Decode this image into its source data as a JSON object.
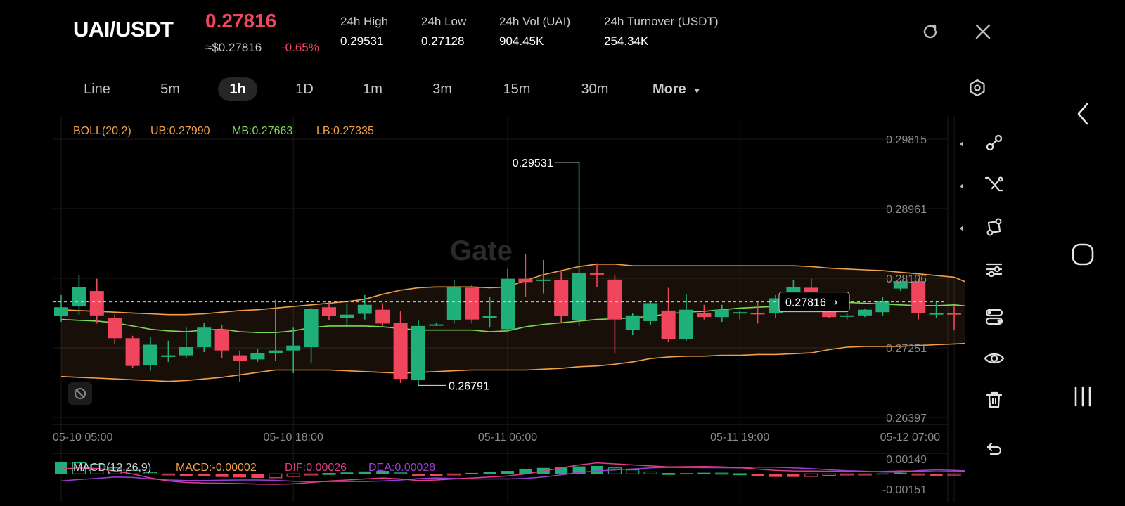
{
  "header": {
    "pair": "UAI/USDT",
    "last_price": "0.27816",
    "approx_price": "≈$0.27816",
    "change_pct": "-0.65%",
    "stats": [
      {
        "label": "24h   High",
        "value": "0.29531"
      },
      {
        "label": "24h   Low",
        "value": "0.27128"
      },
      {
        "label": "24h   Vol (UAI)",
        "value": "904.45K"
      },
      {
        "label": "24h   Turnover (USDT)",
        "value": "254.34K"
      }
    ]
  },
  "timeframes": [
    {
      "label": "Line",
      "active": false
    },
    {
      "label": "5m",
      "active": false
    },
    {
      "label": "1h",
      "active": true
    },
    {
      "label": "1D",
      "active": false
    },
    {
      "label": "1m",
      "active": false
    },
    {
      "label": "3m",
      "active": false
    },
    {
      "label": "15m",
      "active": false
    },
    {
      "label": "30m",
      "active": false
    },
    {
      "label": "More",
      "active": false
    }
  ],
  "indicators": {
    "boll": {
      "name": "BOLL(20,2)",
      "ub": "UB:0.27990",
      "mb": "MB:0.27663",
      "lb": "LB:0.27335"
    },
    "macd": {
      "name": "MACD(12,26,9)",
      "macd": "MACD:-0.00002",
      "dif": "DIF:0.00026",
      "dea": "DEA:0.00028"
    }
  },
  "watermark": "Gate",
  "colors": {
    "up": "#1fb07a",
    "down": "#f0465d",
    "boll_ub": "#f0a04a",
    "boll_mb": "#7ed957",
    "boll_lb": "#f0a04a",
    "dif": "#e03c8a",
    "dea": "#9b3fd6",
    "accent_orange": "#f0a04a"
  },
  "chart_data": {
    "type": "candlestick",
    "y_ticks": [
      "0.29815",
      "0.28961",
      "0.28106",
      "0.27251",
      "0.26397"
    ],
    "ylim": [
      0.26397,
      0.29815
    ],
    "x_ticks": [
      {
        "label": "05-10 05:00",
        "index": 0
      },
      {
        "label": "05-10 18:00",
        "index": 13
      },
      {
        "label": "05-11 06:00",
        "index": 25
      },
      {
        "label": "05-11 19:00",
        "index": 38
      },
      {
        "label": "05-12 07:00",
        "index": 50
      }
    ],
    "current_price": "0.27816",
    "high_marker": {
      "label": "0.29531",
      "index": 29,
      "value": 0.29531
    },
    "low_marker": {
      "label": "0.26791",
      "index": 20,
      "value": 0.26791
    },
    "candles": [
      {
        "o": 0.2764,
        "h": 0.279,
        "l": 0.2757,
        "c": 0.2775
      },
      {
        "o": 0.2776,
        "h": 0.2814,
        "l": 0.2766,
        "c": 0.28
      },
      {
        "o": 0.2795,
        "h": 0.281,
        "l": 0.2755,
        "c": 0.2765
      },
      {
        "o": 0.2762,
        "h": 0.2766,
        "l": 0.273,
        "c": 0.2737
      },
      {
        "o": 0.2737,
        "h": 0.274,
        "l": 0.27,
        "c": 0.2703
      },
      {
        "o": 0.2704,
        "h": 0.2738,
        "l": 0.2697,
        "c": 0.2729
      },
      {
        "o": 0.2714,
        "h": 0.2734,
        "l": 0.2708,
        "c": 0.2716
      },
      {
        "o": 0.2716,
        "h": 0.275,
        "l": 0.2713,
        "c": 0.2726
      },
      {
        "o": 0.2726,
        "h": 0.2756,
        "l": 0.272,
        "c": 0.275
      },
      {
        "o": 0.2748,
        "h": 0.2753,
        "l": 0.2713,
        "c": 0.2722
      },
      {
        "o": 0.2716,
        "h": 0.2722,
        "l": 0.2683,
        "c": 0.2709
      },
      {
        "o": 0.2711,
        "h": 0.2724,
        "l": 0.2708,
        "c": 0.2719
      },
      {
        "o": 0.2719,
        "h": 0.2784,
        "l": 0.2709,
        "c": 0.2722
      },
      {
        "o": 0.2722,
        "h": 0.275,
        "l": 0.2694,
        "c": 0.2728
      },
      {
        "o": 0.2726,
        "h": 0.2774,
        "l": 0.2706,
        "c": 0.2773
      },
      {
        "o": 0.2775,
        "h": 0.2782,
        "l": 0.2759,
        "c": 0.2764
      },
      {
        "o": 0.2762,
        "h": 0.278,
        "l": 0.275,
        "c": 0.2766
      },
      {
        "o": 0.2767,
        "h": 0.279,
        "l": 0.276,
        "c": 0.2778
      },
      {
        "o": 0.2772,
        "h": 0.278,
        "l": 0.2752,
        "c": 0.2755
      },
      {
        "o": 0.2756,
        "h": 0.277,
        "l": 0.2682,
        "c": 0.2687
      },
      {
        "o": 0.2686,
        "h": 0.2759,
        "l": 0.2679,
        "c": 0.2752
      },
      {
        "o": 0.2754,
        "h": 0.2756,
        "l": 0.2752,
        "c": 0.2754
      },
      {
        "o": 0.2759,
        "h": 0.2809,
        "l": 0.2755,
        "c": 0.28
      },
      {
        "o": 0.2799,
        "h": 0.2803,
        "l": 0.2755,
        "c": 0.276
      },
      {
        "o": 0.2763,
        "h": 0.2788,
        "l": 0.275,
        "c": 0.2764
      },
      {
        "o": 0.2748,
        "h": 0.2822,
        "l": 0.2744,
        "c": 0.281
      },
      {
        "o": 0.281,
        "h": 0.2841,
        "l": 0.2788,
        "c": 0.2806
      },
      {
        "o": 0.2808,
        "h": 0.2833,
        "l": 0.2792,
        "c": 0.2809
      },
      {
        "o": 0.2808,
        "h": 0.282,
        "l": 0.2756,
        "c": 0.2764
      },
      {
        "o": 0.2759,
        "h": 0.2953,
        "l": 0.2752,
        "c": 0.2817
      },
      {
        "o": 0.2817,
        "h": 0.2829,
        "l": 0.28,
        "c": 0.2815
      },
      {
        "o": 0.2809,
        "h": 0.2814,
        "l": 0.2718,
        "c": 0.276
      },
      {
        "o": 0.2747,
        "h": 0.2768,
        "l": 0.2741,
        "c": 0.2765
      },
      {
        "o": 0.2758,
        "h": 0.2783,
        "l": 0.2753,
        "c": 0.278
      },
      {
        "o": 0.2771,
        "h": 0.2799,
        "l": 0.2732,
        "c": 0.2736
      },
      {
        "o": 0.2736,
        "h": 0.2791,
        "l": 0.2734,
        "c": 0.2772
      },
      {
        "o": 0.2768,
        "h": 0.2778,
        "l": 0.276,
        "c": 0.2763
      },
      {
        "o": 0.2763,
        "h": 0.2778,
        "l": 0.2757,
        "c": 0.2772
      },
      {
        "o": 0.2769,
        "h": 0.2771,
        "l": 0.276,
        "c": 0.2769
      },
      {
        "o": 0.2768,
        "h": 0.2781,
        "l": 0.2755,
        "c": 0.2767
      },
      {
        "o": 0.2768,
        "h": 0.279,
        "l": 0.2762,
        "c": 0.2786
      },
      {
        "o": 0.2792,
        "h": 0.2808,
        "l": 0.278,
        "c": 0.28
      },
      {
        "o": 0.2799,
        "h": 0.281,
        "l": 0.279,
        "c": 0.2792
      },
      {
        "o": 0.2774,
        "h": 0.2786,
        "l": 0.2762,
        "c": 0.2763
      },
      {
        "o": 0.2765,
        "h": 0.2768,
        "l": 0.276,
        "c": 0.2765
      },
      {
        "o": 0.2765,
        "h": 0.2773,
        "l": 0.2763,
        "c": 0.2772
      },
      {
        "o": 0.2769,
        "h": 0.2788,
        "l": 0.2764,
        "c": 0.2783
      },
      {
        "o": 0.2798,
        "h": 0.2808,
        "l": 0.2795,
        "c": 0.2807
      },
      {
        "o": 0.2807,
        "h": 0.281,
        "l": 0.276,
        "c": 0.2768
      },
      {
        "o": 0.2766,
        "h": 0.2782,
        "l": 0.2762,
        "c": 0.2768
      },
      {
        "o": 0.2768,
        "h": 0.2776,
        "l": 0.2747,
        "c": 0.2766
      },
      {
        "o": 0.2767,
        "h": 0.2782,
        "l": 0.2762,
        "c": 0.2778
      }
    ],
    "boll_ub": [
      0.2772,
      0.2771,
      0.277,
      0.2769,
      0.2768,
      0.2767,
      0.2766,
      0.2766,
      0.2767,
      0.2769,
      0.2771,
      0.2772,
      0.2774,
      0.2776,
      0.2778,
      0.278,
      0.2782,
      0.2785,
      0.2791,
      0.2796,
      0.2799,
      0.28,
      0.28,
      0.28,
      0.2799,
      0.28,
      0.2808,
      0.2815,
      0.282,
      0.2825,
      0.2828,
      0.2828,
      0.2826,
      0.2826,
      0.2826,
      0.2826,
      0.2826,
      0.2826,
      0.2826,
      0.2826,
      0.2826,
      0.2826,
      0.2825,
      0.2823,
      0.2822,
      0.2821,
      0.282,
      0.2818,
      0.2816,
      0.2814,
      0.2812,
      0.2803
    ],
    "boll_mb": [
      0.276,
      0.2759,
      0.2758,
      0.2756,
      0.2752,
      0.2748,
      0.2746,
      0.2745,
      0.2747,
      0.2748,
      0.2745,
      0.2744,
      0.2744,
      0.2746,
      0.275,
      0.2752,
      0.2752,
      0.2752,
      0.2751,
      0.2749,
      0.2747,
      0.2747,
      0.2747,
      0.2747,
      0.2745,
      0.2746,
      0.2751,
      0.2754,
      0.2756,
      0.2758,
      0.276,
      0.2761,
      0.2762,
      0.2764,
      0.2767,
      0.2769,
      0.277,
      0.2772,
      0.2774,
      0.2775,
      0.2776,
      0.2777,
      0.278,
      0.2782,
      0.2781,
      0.278,
      0.2779,
      0.2778,
      0.2777,
      0.2777,
      0.2778,
      0.2776
    ],
    "boll_lb": [
      0.269,
      0.2689,
      0.2688,
      0.2687,
      0.2686,
      0.2685,
      0.2684,
      0.2685,
      0.2687,
      0.2689,
      0.2692,
      0.2695,
      0.2698,
      0.2698,
      0.2698,
      0.2698,
      0.2697,
      0.2696,
      0.2695,
      0.2694,
      0.2695,
      0.2696,
      0.2697,
      0.2698,
      0.2698,
      0.2698,
      0.2698,
      0.2699,
      0.27,
      0.2702,
      0.2703,
      0.2705,
      0.2708,
      0.2712,
      0.2714,
      0.2715,
      0.2715,
      0.2716,
      0.2716,
      0.2717,
      0.2717,
      0.2718,
      0.2719,
      0.2723,
      0.2726,
      0.2727,
      0.2727,
      0.2727,
      0.2728,
      0.2729,
      0.273,
      0.2731
    ],
    "macd": {
      "ylim": [
        -0.00151,
        0.00149
      ],
      "y_ticks": [
        "0.00149",
        "-0.00151"
      ],
      "hist": [
        0.0012,
        0.0011,
        0.00095,
        0.0006,
        0.00035,
        0.00015,
        -0.0001,
        -0.0002,
        -0.00025,
        -0.0003,
        -0.00035,
        -0.0004,
        -0.00038,
        -0.00025,
        -8e-05,
        5e-05,
        0.00015,
        0.00025,
        0.0003,
        0.0001,
        -0.00018,
        -0.0002,
        -5e-05,
        0.0001,
        0.0002,
        0.0003,
        0.00045,
        0.0006,
        0.0007,
        0.00075,
        0.0008,
        0.0006,
        0.0004,
        0.0002,
        5e-05,
        8e-05,
        0.00012,
        8e-05,
        2e-05,
        -0.0002,
        -0.0003,
        -0.0003,
        -0.00025,
        -0.00015,
        -8e-05,
        -5e-05,
        5e-05,
        0.00012,
        -8e-05,
        -0.00018,
        -0.00012,
        -2e-05
      ],
      "dif": [
        0.0005,
        0.0006,
        0.00055,
        0.0003,
        0.0,
        -0.0004,
        -0.0007,
        -0.00085,
        -0.0009,
        -0.00092,
        -0.00095,
        -0.001,
        -0.00102,
        -0.00098,
        -0.00085,
        -0.0007,
        -0.0006,
        -0.0005,
        -0.0004,
        -0.0005,
        -0.00065,
        -0.0006,
        -0.0005,
        -0.0004,
        -0.0003,
        -0.0002,
        0.0,
        0.0003,
        0.0006,
        0.0009,
        0.0011,
        0.001,
        0.0009,
        0.0008,
        0.0007,
        0.00072,
        0.00074,
        0.0007,
        0.00062,
        0.00048,
        0.00036,
        0.0003,
        0.00028,
        0.00026,
        0.00024,
        0.00022,
        0.00024,
        0.0003,
        0.00026,
        0.00022,
        0.00024,
        0.00026
      ],
      "dea": [
        -0.0007,
        -0.00055,
        -0.00045,
        -0.0003,
        -0.00035,
        -0.0005,
        -0.0006,
        -0.00065,
        -0.00065,
        -0.00062,
        -0.0006,
        -0.0006,
        -0.00064,
        -0.00073,
        -0.00077,
        -0.00075,
        -0.00075,
        -0.00075,
        -0.0007,
        -0.0006,
        -0.00047,
        -0.0004,
        -0.00045,
        -0.0005,
        -0.0005,
        -0.0005,
        -0.00045,
        -0.0003,
        -0.0001,
        0.00015,
        0.0003,
        0.0004,
        0.0005,
        0.0006,
        0.00065,
        0.00064,
        0.00062,
        0.00062,
        0.0006,
        0.00068,
        0.00066,
        0.0006,
        0.00053,
        0.00041,
        0.00032,
        0.00027,
        0.00019,
        0.00018,
        0.00034,
        0.0004,
        0.00036,
        0.00028
      ]
    }
  }
}
